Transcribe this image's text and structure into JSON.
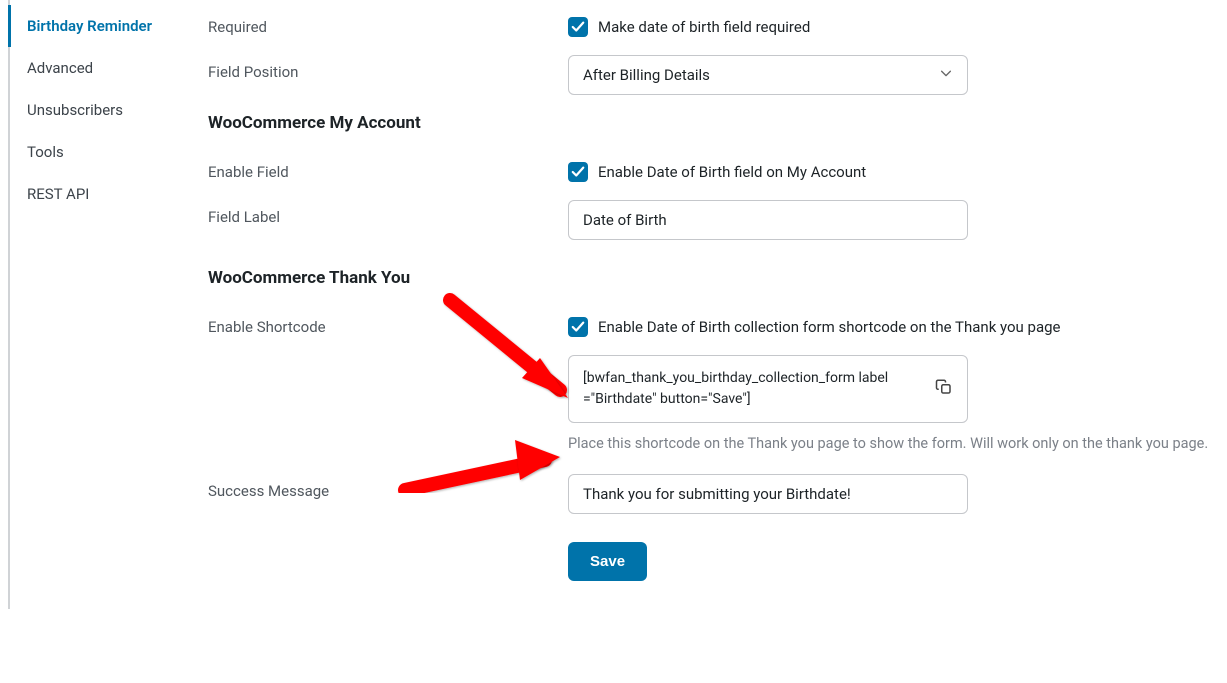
{
  "sidebar": {
    "items": [
      {
        "label": "Birthday Reminder",
        "active": true
      },
      {
        "label": "Advanced",
        "active": false
      },
      {
        "label": "Unsubscribers",
        "active": false
      },
      {
        "label": "Tools",
        "active": false
      },
      {
        "label": "REST API",
        "active": false
      }
    ]
  },
  "form": {
    "required_label": "Required",
    "required_text": "Make date of birth field required",
    "position_label": "Field Position",
    "position_value": "After Billing Details",
    "section_account": "WooCommerce My Account",
    "enable_field_label": "Enable Field",
    "enable_field_text": "Enable Date of Birth field on My Account",
    "field_label_label": "Field Label",
    "field_label_value": "Date of Birth",
    "section_thankyou": "WooCommerce Thank You",
    "enable_shortcode_label": "Enable Shortcode",
    "enable_shortcode_text": "Enable Date of Birth collection form shortcode on the Thank you page",
    "shortcode_value": "[bwfan_thank_you_birthday_collection_form label =\"Birthdate\" button=\"Save\"]",
    "shortcode_hint": "Place this shortcode on the Thank you page to show the form. Will work only on the thank you page.",
    "success_label": "Success Message",
    "success_value": "Thank you for submitting your Birthdate!",
    "save_button": "Save"
  }
}
